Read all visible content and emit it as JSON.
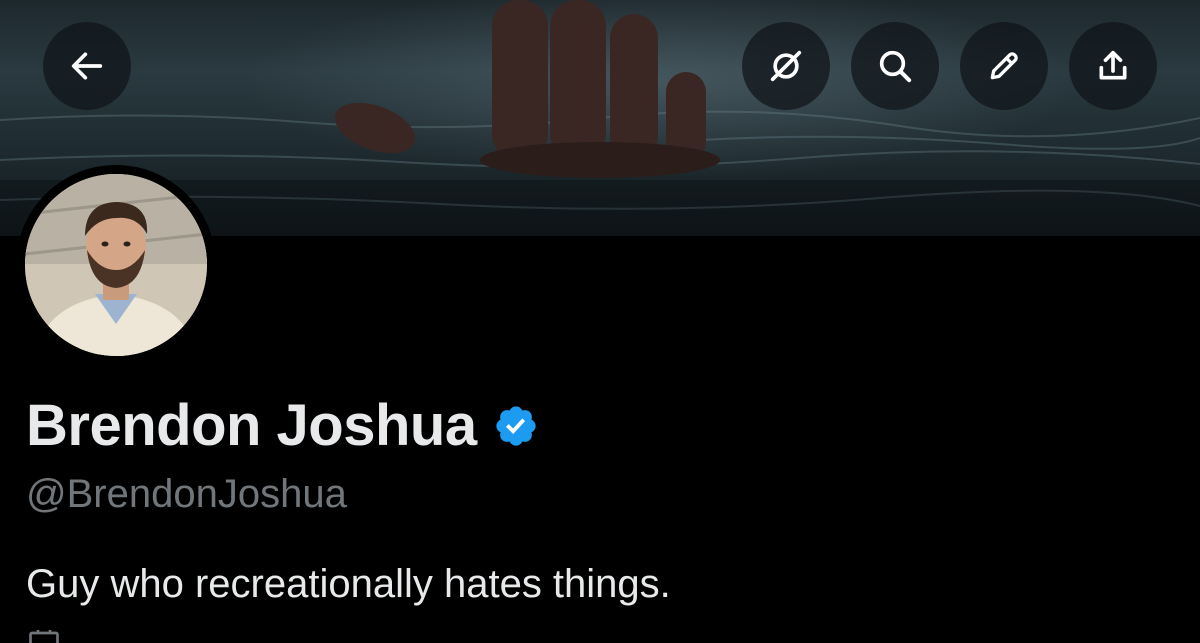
{
  "toolbar": {
    "back_icon": "arrow-left-icon",
    "grok_icon": "grok-icon",
    "search_icon": "search-icon",
    "edit_icon": "pencil-icon",
    "share_icon": "share-icon"
  },
  "profile": {
    "display_name": "Brendon Joshua",
    "verified_icon": "verified-badge-icon",
    "handle": "@BrendonJoshua",
    "bio": "Guy who recreationally hates things."
  },
  "colors": {
    "background": "#000000",
    "primary_text": "#e7e9ea",
    "secondary_text": "#71767b",
    "verified_blue": "#1d9bf0",
    "button_bg": "#0f1419"
  }
}
